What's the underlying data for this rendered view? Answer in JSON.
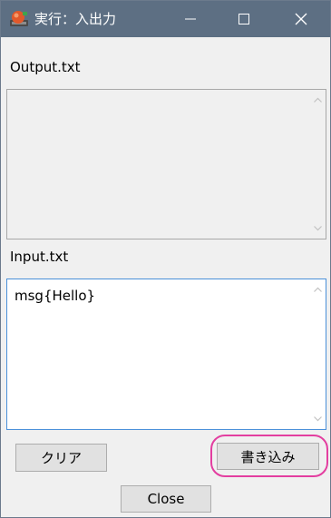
{
  "window": {
    "title": "実行：入出力",
    "icons": {
      "app": "app-icon",
      "minimize": "minimize-icon",
      "maximize": "maximize-icon",
      "close": "close-icon"
    }
  },
  "output": {
    "label": "Output.txt",
    "content": ""
  },
  "input": {
    "label": "Input.txt",
    "content": "msg{Hello}"
  },
  "buttons": {
    "clear": "クリア",
    "write": "書き込み",
    "close": "Close"
  },
  "colors": {
    "titlebar": "#5d6f83",
    "highlight": "#e33ea0",
    "input_border": "#4a90d9"
  }
}
